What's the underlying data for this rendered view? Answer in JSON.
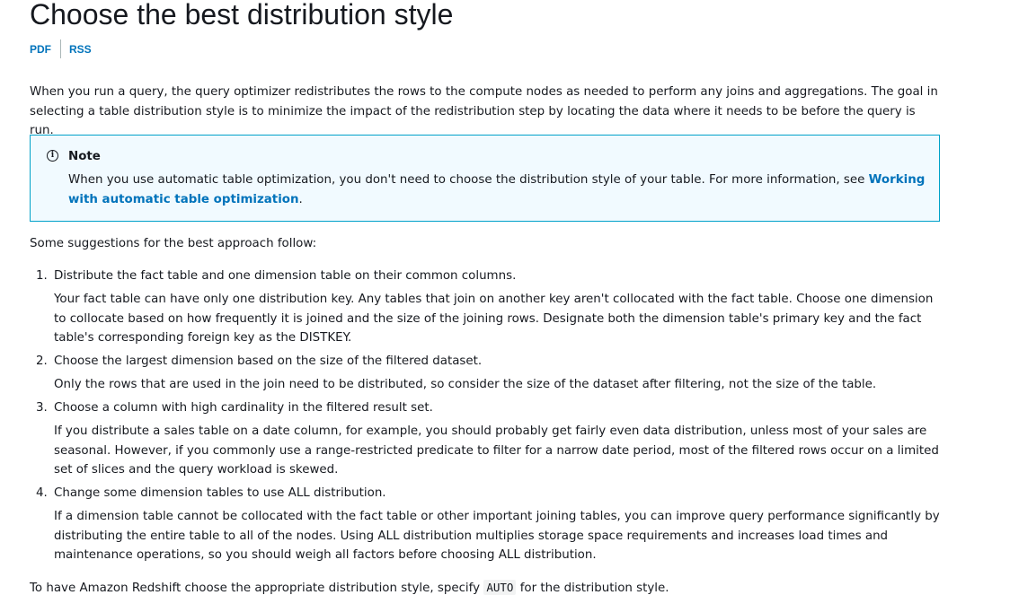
{
  "page_title": "Choose the best distribution style",
  "doc_links": {
    "pdf": "PDF",
    "rss": "RSS"
  },
  "intro": "When you run a query, the query optimizer redistributes the rows to the compute nodes as needed to perform any joins and aggregations. The goal in selecting a table distribution style is to minimize the impact of the redistribution step by locating the data where it needs to be before the query is run.",
  "note": {
    "icon": "info-icon",
    "title": "Note",
    "text_before": "When you use automatic table optimization, you don't need to choose the distribution style of your table. For more information, see ",
    "link_text": "Working with automatic table optimization",
    "text_after": ".",
    "accent_color": "#00a1c9",
    "background_color": "#f1faff"
  },
  "suggestions_intro": "Some suggestions for the best approach follow:",
  "suggestions": [
    {
      "number": "1.",
      "heading": "Distribute the fact table and one dimension table on their common columns.",
      "detail": "Your fact table can have only one distribution key. Any tables that join on another key aren't collocated with the fact table. Choose one dimension to collocate based on how frequently it is joined and the size of the joining rows. Designate both the dimension table's primary key and the fact table's corresponding foreign key as the DISTKEY."
    },
    {
      "number": "2.",
      "heading": "Choose the largest dimension based on the size of the filtered dataset.",
      "detail": "Only the rows that are used in the join need to be distributed, so consider the size of the dataset after filtering, not the size of the table."
    },
    {
      "number": "3.",
      "heading": "Choose a column with high cardinality in the filtered result set.",
      "detail": "If you distribute a sales table on a date column, for example, you should probably get fairly even data distribution, unless most of your sales are seasonal. However, if you commonly use a range-restricted predicate to filter for a narrow date period, most of the filtered rows occur on a limited set of slices and the query workload is skewed."
    },
    {
      "number": "4.",
      "heading": "Change some dimension tables to use ALL distribution.",
      "detail": "If a dimension table cannot be collocated with the fact table or other important joining tables, you can improve query performance significantly by distributing the entire table to all of the nodes. Using ALL distribution multiplies storage space requirements and increases load times and maintenance operations, so you should weigh all factors before choosing ALL distribution."
    }
  ],
  "footer": {
    "text_before": "To have Amazon Redshift choose the appropriate distribution style, specify ",
    "code": "AUTO",
    "text_after": " for the distribution style."
  },
  "colors": {
    "text": "#16191f",
    "link": "#0073bb"
  }
}
